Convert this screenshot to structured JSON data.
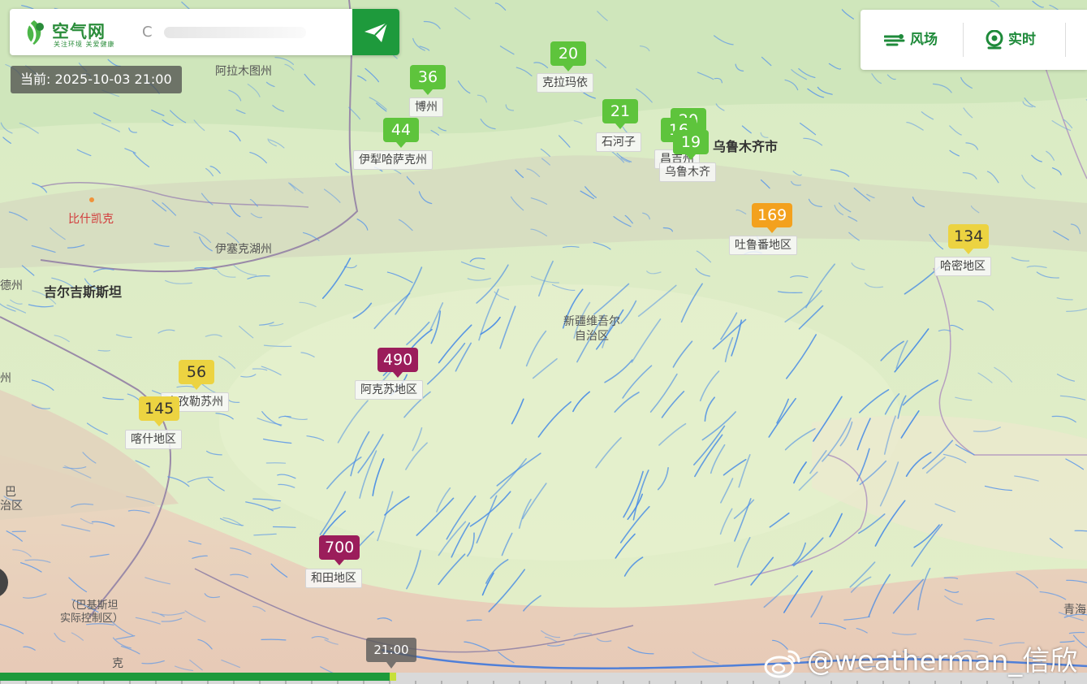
{
  "header": {
    "logo_name": "空气网",
    "logo_slogan": "关注环境 关爱健康",
    "search_value": "",
    "search_placeholder": ""
  },
  "current_time": "当前: 2025-10-03 21:00",
  "toolbar": {
    "wind_label": "风场",
    "realtime_label": "实时"
  },
  "stations": [
    {
      "name": "博州",
      "aqi": "36",
      "level": "good"
    },
    {
      "name": "克拉玛依",
      "aqi": "20",
      "level": "good"
    },
    {
      "name": "石河子",
      "aqi": "21",
      "level": "good"
    },
    {
      "name": "伊犁哈萨克州",
      "aqi": "44",
      "level": "good"
    },
    {
      "name": "昌吉州",
      "aqi": "16",
      "level": "good"
    },
    {
      "name": "",
      "aqi": "20",
      "level": "good"
    },
    {
      "name": "乌鲁木齐",
      "aqi": "19",
      "level": "good"
    },
    {
      "name": "吐鲁番地区",
      "aqi": "169",
      "level": "usg"
    },
    {
      "name": "哈密地区",
      "aqi": "134",
      "level": "mod"
    },
    {
      "name": "阿克苏地区",
      "aqi": "490",
      "level": "haz"
    },
    {
      "name": "克孜勒苏州",
      "aqi": "56",
      "level": "mod"
    },
    {
      "name": "喀什地区",
      "aqi": "145",
      "level": "mod"
    },
    {
      "name": "和田地区",
      "aqi": "700",
      "level": "haz"
    }
  ],
  "map_labels": {
    "almaty": "阿拉木图州",
    "bishkek": "比什凯克",
    "issyk": "伊塞克湖州",
    "kyrgyz": "吉尔吉斯斯坦",
    "urumqi_city": "乌鲁木齐市",
    "xinjiang": "新疆维吾尔\n自治区",
    "pakistan": "（巴基斯坦\n实际控制区）",
    "qinghai": "青海",
    "left1": "德州",
    "left2": "州",
    "left3": "巴",
    "left4": "治区",
    "bottom_k": "克"
  },
  "timeline": {
    "current_label": "21:00",
    "progress": 0.36
  },
  "watermark": "@weatherman_信欣",
  "colors": {
    "good": "#5ec43c",
    "moderate": "#ecd341",
    "usg": "#f3a11e",
    "hazardous": "#9b1d5b",
    "brand": "#1e9a3c"
  }
}
